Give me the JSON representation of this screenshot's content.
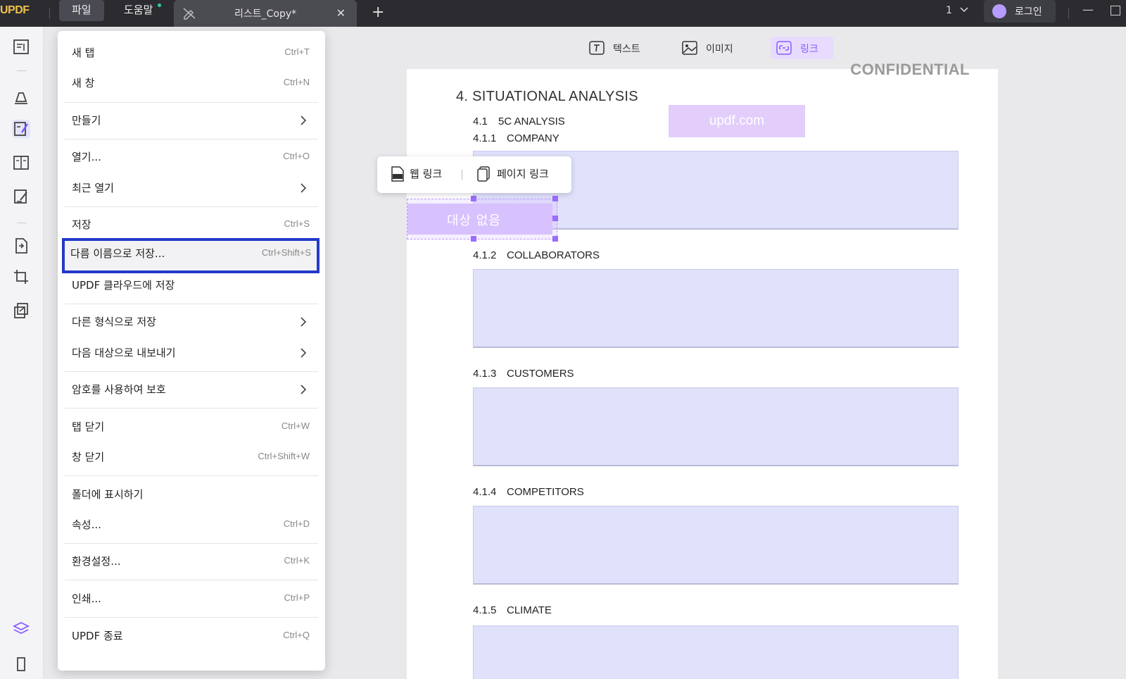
{
  "titlebar": {
    "logo": "UPDF",
    "menus": [
      "파일",
      "도움말"
    ],
    "tab_title": "리스트_Copy*",
    "tab_close": "✕",
    "tab_add": "+",
    "page_number": "1",
    "login": "로그인",
    "minimize": "—"
  },
  "edit_toolbar": {
    "text": "텍스트",
    "image": "이미지",
    "link": "링크"
  },
  "document": {
    "confidential": "CONFIDENTIAL",
    "section_title": "4.  SITUATIONAL ANALYSIS",
    "watermark": "updf.com",
    "sections": [
      {
        "num": "4.1",
        "title": "5C ANALYSIS"
      },
      {
        "num": "4.1.1",
        "title": "COMPANY"
      },
      {
        "num": "4.1.2",
        "title": "COLLABORATORS"
      },
      {
        "num": "4.1.3",
        "title": "CUSTOMERS"
      },
      {
        "num": "4.1.4",
        "title": "COMPETITORS"
      },
      {
        "num": "4.1.5",
        "title": "CLIMATE"
      }
    ],
    "link_popover": {
      "web_link": "웹 링크",
      "page_link": "페이지 링크"
    },
    "link_target_label": "대상 없음"
  },
  "file_menu": {
    "items": [
      {
        "label": "새 탭",
        "shortcut": "Ctrl+T"
      },
      {
        "label": "새 창",
        "shortcut": "Ctrl+N"
      },
      {
        "label": "만들기",
        "shortcut": ""
      },
      {
        "label": "열기...",
        "shortcut": "Ctrl+O"
      },
      {
        "label": "최근 열기",
        "shortcut": ""
      },
      {
        "label": "저장",
        "shortcut": "Ctrl+S"
      },
      {
        "label": "다름 이름으로 저장...",
        "shortcut": "Ctrl+Shift+S"
      },
      {
        "label": "UPDF 클라우드에 저장",
        "shortcut": ""
      },
      {
        "label": "다른 형식으로 저장",
        "shortcut": ""
      },
      {
        "label": "다음 대상으로 내보내기",
        "shortcut": ""
      },
      {
        "label": "암호를 사용하여 보호",
        "shortcut": ""
      },
      {
        "label": "탭 닫기",
        "shortcut": "Ctrl+W"
      },
      {
        "label": "창 닫기",
        "shortcut": "Ctrl+Shift+W"
      },
      {
        "label": "폴더에 표시하기",
        "shortcut": ""
      },
      {
        "label": "속성...",
        "shortcut": "Ctrl+D"
      },
      {
        "label": "환경설정...",
        "shortcut": "Ctrl+K"
      },
      {
        "label": "인쇄...",
        "shortcut": "Ctrl+P"
      },
      {
        "label": "UPDF 종료",
        "shortcut": "Ctrl+Q"
      }
    ]
  },
  "colors": {
    "highlight_border": "#2439c9",
    "accent": "#8a5cff",
    "form_field": "#e0e1fb"
  }
}
